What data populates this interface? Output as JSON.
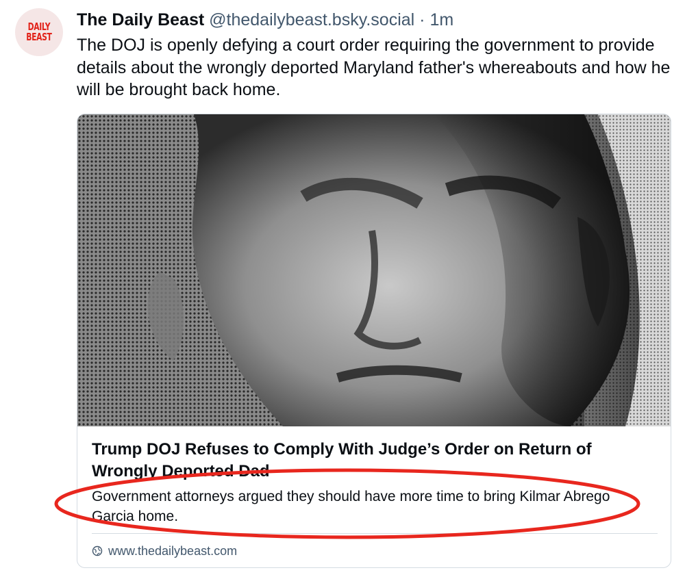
{
  "post": {
    "avatar_text": "DAILY BEAST",
    "author_name": "The Daily Beast",
    "handle": "@thedailybeast.bsky.social",
    "separator": "·",
    "time": "1m",
    "text": "The DOJ is openly defying a court order requiring the government to provide details about the wrongly deported Maryland father's whereabouts and how he will be brought back home."
  },
  "link_card": {
    "title": "Trump DOJ Refuses to Comply With Judge’s Order on Return of Wrongly Deported Dad",
    "description": "Government attorneys argued they should have more time to bring Kilmar Abrego Garcia home.",
    "domain": "www.thedailybeast.com",
    "domain_icon": "globe-icon"
  },
  "colors": {
    "brand_red": "#e2231a",
    "annotation_red": "#e8271e",
    "muted_text": "#42576c",
    "border": "#d4dbe2"
  }
}
